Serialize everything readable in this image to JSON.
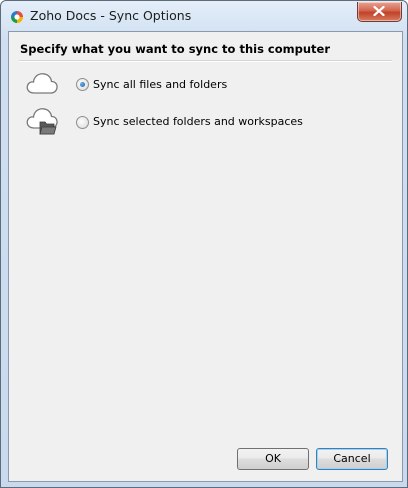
{
  "window": {
    "title": "Zoho Docs - Sync Options",
    "icon": "zoho-docs-logo-icon",
    "close_icon": "close-icon"
  },
  "heading": "Specify what you want to sync to this computer",
  "options": [
    {
      "label": "Sync all files and folders",
      "selected": true,
      "icon": "cloud-icon"
    },
    {
      "label": "Sync selected folders and workspaces",
      "selected": false,
      "icon": "cloud-folder-icon"
    }
  ],
  "buttons": {
    "ok": "OK",
    "cancel": "Cancel"
  },
  "colors": {
    "accent": "#1b5d9b",
    "close_button": "#c7472f",
    "dialog_bg": "#f0f0f0"
  }
}
